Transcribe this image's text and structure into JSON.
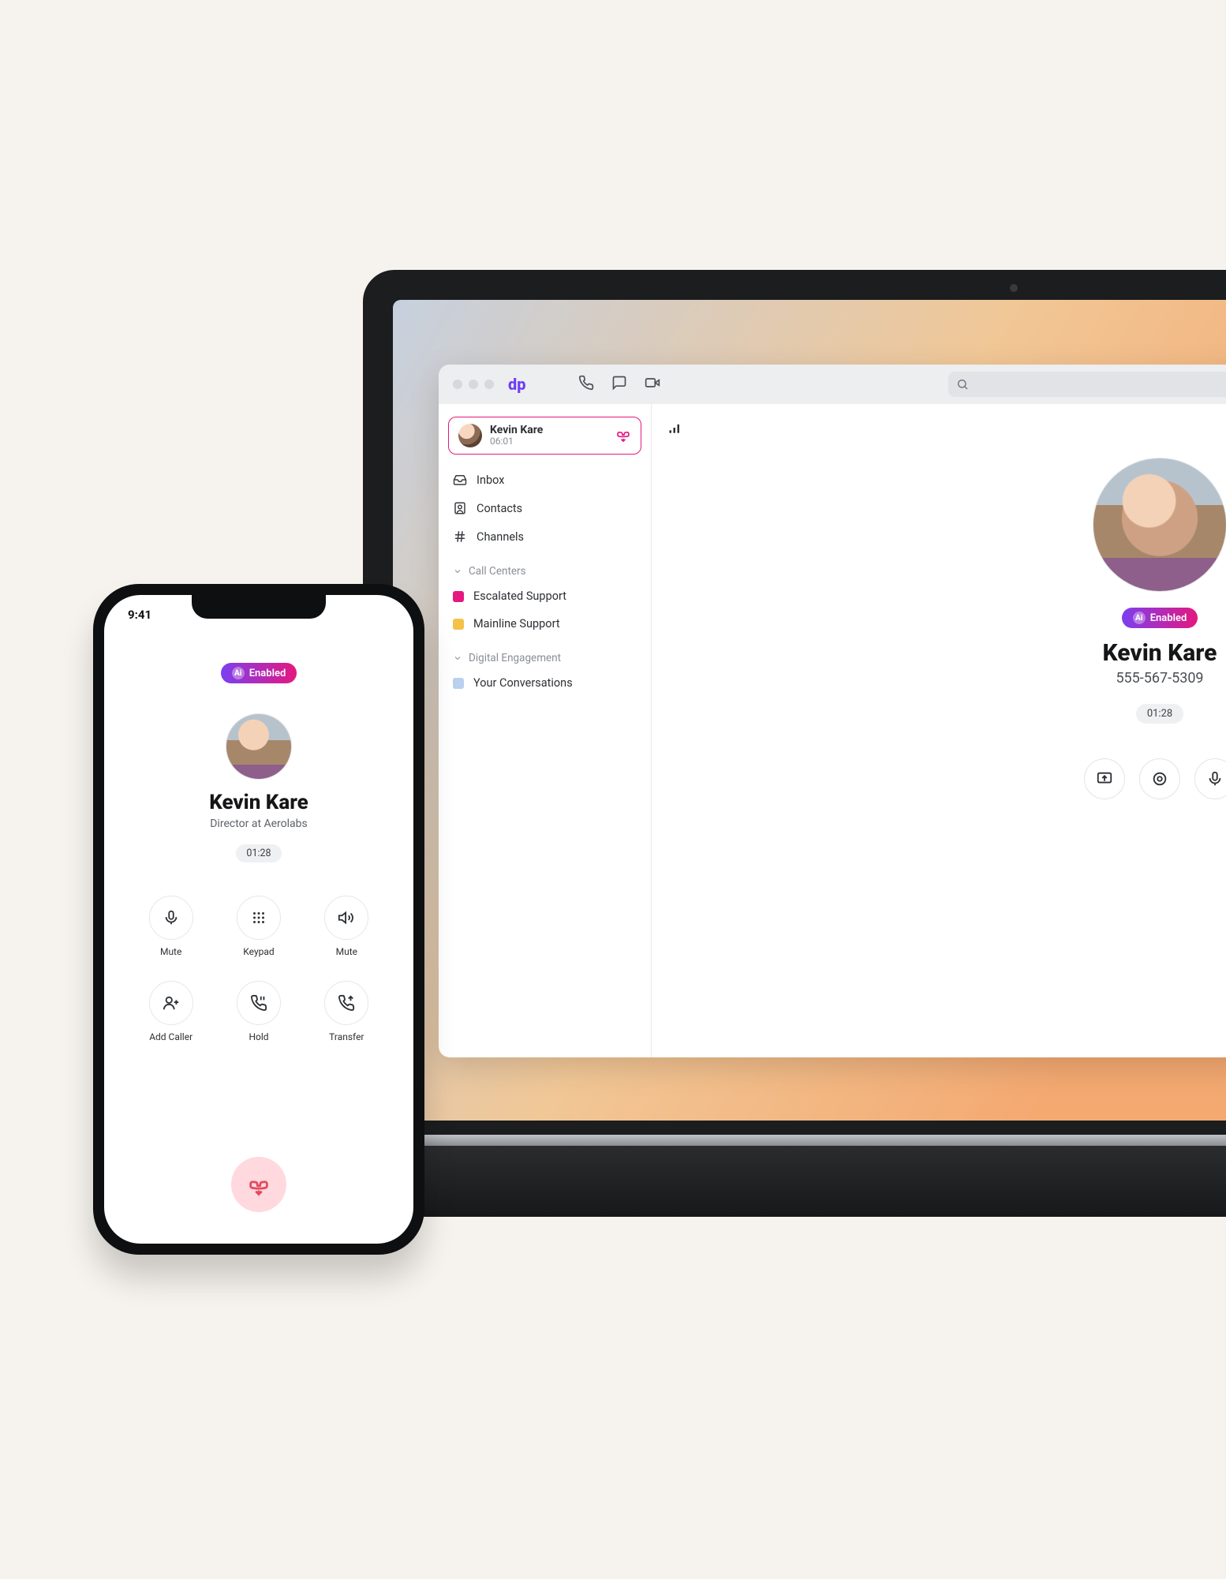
{
  "desktop": {
    "titlebar": {
      "logo": "dp"
    },
    "active_call": {
      "name": "Kevin Kare",
      "time": "06:01"
    },
    "nav": {
      "inbox": "Inbox",
      "contacts": "Contacts",
      "channels": "Channels"
    },
    "call_centers_section": "Call Centers",
    "call_centers": [
      {
        "label": "Escalated Support",
        "color": "#e5187f"
      },
      {
        "label": "Mainline Support",
        "color": "#f4c24a"
      }
    ],
    "digital_section": "Digital Engagement",
    "digital_items": [
      {
        "label": "Your Conversations",
        "color": "#b9d0ee"
      }
    ],
    "profile": {
      "ai_badge": "Enabled",
      "name": "Kevin Kare",
      "phone": "555-567-5309",
      "timer": "01:28"
    }
  },
  "phone": {
    "status_time": "9:41",
    "ai_badge": "Enabled",
    "name": "Kevin Kare",
    "subtitle": "Director at Aerolabs",
    "timer": "01:28",
    "actions": {
      "mute": "Mute",
      "keypad": "Keypad",
      "speaker": "Mute",
      "add_caller": "Add Caller",
      "hold": "Hold",
      "transfer": "Transfer"
    }
  }
}
